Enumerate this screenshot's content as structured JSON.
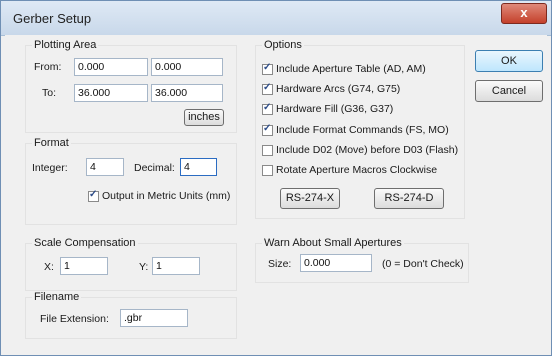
{
  "window": {
    "title": "Gerber Setup",
    "close_glyph": "x"
  },
  "plotting_area": {
    "legend": "Plotting Area",
    "from_label": "From:",
    "to_label": "To:",
    "from_x": "0.000",
    "from_y": "0.000",
    "to_x": "36.000",
    "to_y": "36.000",
    "units_button": "inches"
  },
  "format": {
    "legend": "Format",
    "integer_label": "Integer:",
    "integer_value": "4",
    "decimal_label": "Decimal:",
    "decimal_value": "4",
    "metric_label": "Output in Metric Units (mm)",
    "metric_checked": true
  },
  "scale": {
    "legend": "Scale Compensation",
    "x_label": "X:",
    "x_value": "1",
    "y_label": "Y:",
    "y_value": "1"
  },
  "filename": {
    "legend": "Filename",
    "ext_label": "File Extension:",
    "ext_value": ".gbr"
  },
  "options": {
    "legend": "Options",
    "items": [
      {
        "label": "Include Aperture Table (AD, AM)",
        "checked": true
      },
      {
        "label": "Hardware Arcs (G74, G75)",
        "checked": true
      },
      {
        "label": "Hardware Fill (G36, G37)",
        "checked": true
      },
      {
        "label": "Include Format Commands (FS, MO)",
        "checked": true
      },
      {
        "label": "Include D02 (Move) before D03 (Flash)",
        "checked": false
      },
      {
        "label": "Rotate Aperture Macros Clockwise",
        "checked": false
      }
    ],
    "rs274x_button": "RS-274-X",
    "rs274d_button": "RS-274-D"
  },
  "warn": {
    "legend": "Warn About Small Apertures",
    "size_label": "Size:",
    "size_value": "0.000",
    "hint": "(0 = Don't Check)"
  },
  "buttons": {
    "ok": "OK",
    "cancel": "Cancel"
  }
}
